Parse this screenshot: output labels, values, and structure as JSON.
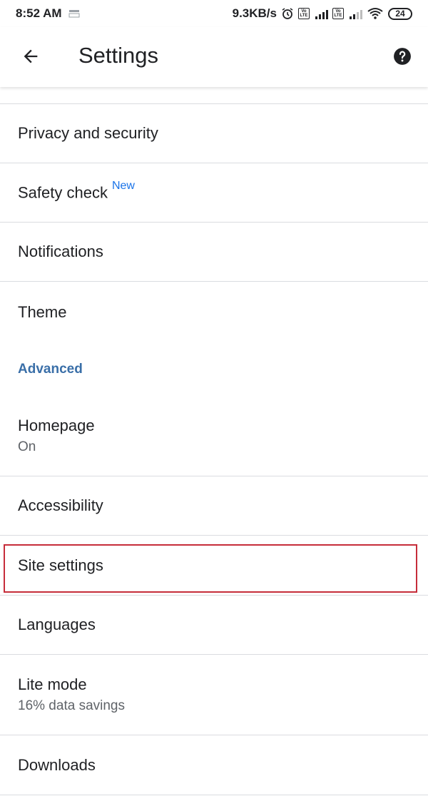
{
  "status_bar": {
    "time": "8:52 AM",
    "network_speed": "9.3KB/s",
    "battery": "24",
    "volte_label_top": "Vo",
    "volte_label_bottom": "LTE"
  },
  "toolbar": {
    "title": "Settings",
    "back_icon": "arrow-back-icon",
    "help_icon": "help-icon"
  },
  "settings": {
    "items": [
      {
        "label": "Privacy and security"
      },
      {
        "label": "Safety check",
        "badge": "New"
      },
      {
        "label": "Notifications"
      },
      {
        "label": "Theme"
      }
    ],
    "advanced_header": "Advanced",
    "advanced_items": [
      {
        "label": "Homepage",
        "sub": "On"
      },
      {
        "label": "Accessibility"
      },
      {
        "label": "Site settings",
        "highlighted": true
      },
      {
        "label": "Languages"
      },
      {
        "label": "Lite mode",
        "sub": "16% data savings"
      },
      {
        "label": "Downloads"
      }
    ]
  },
  "colors": {
    "accent_header": "#3a6fa8",
    "new_badge": "#1a73e8",
    "highlight_border": "#c62d3a",
    "divider": "#dadce0"
  }
}
